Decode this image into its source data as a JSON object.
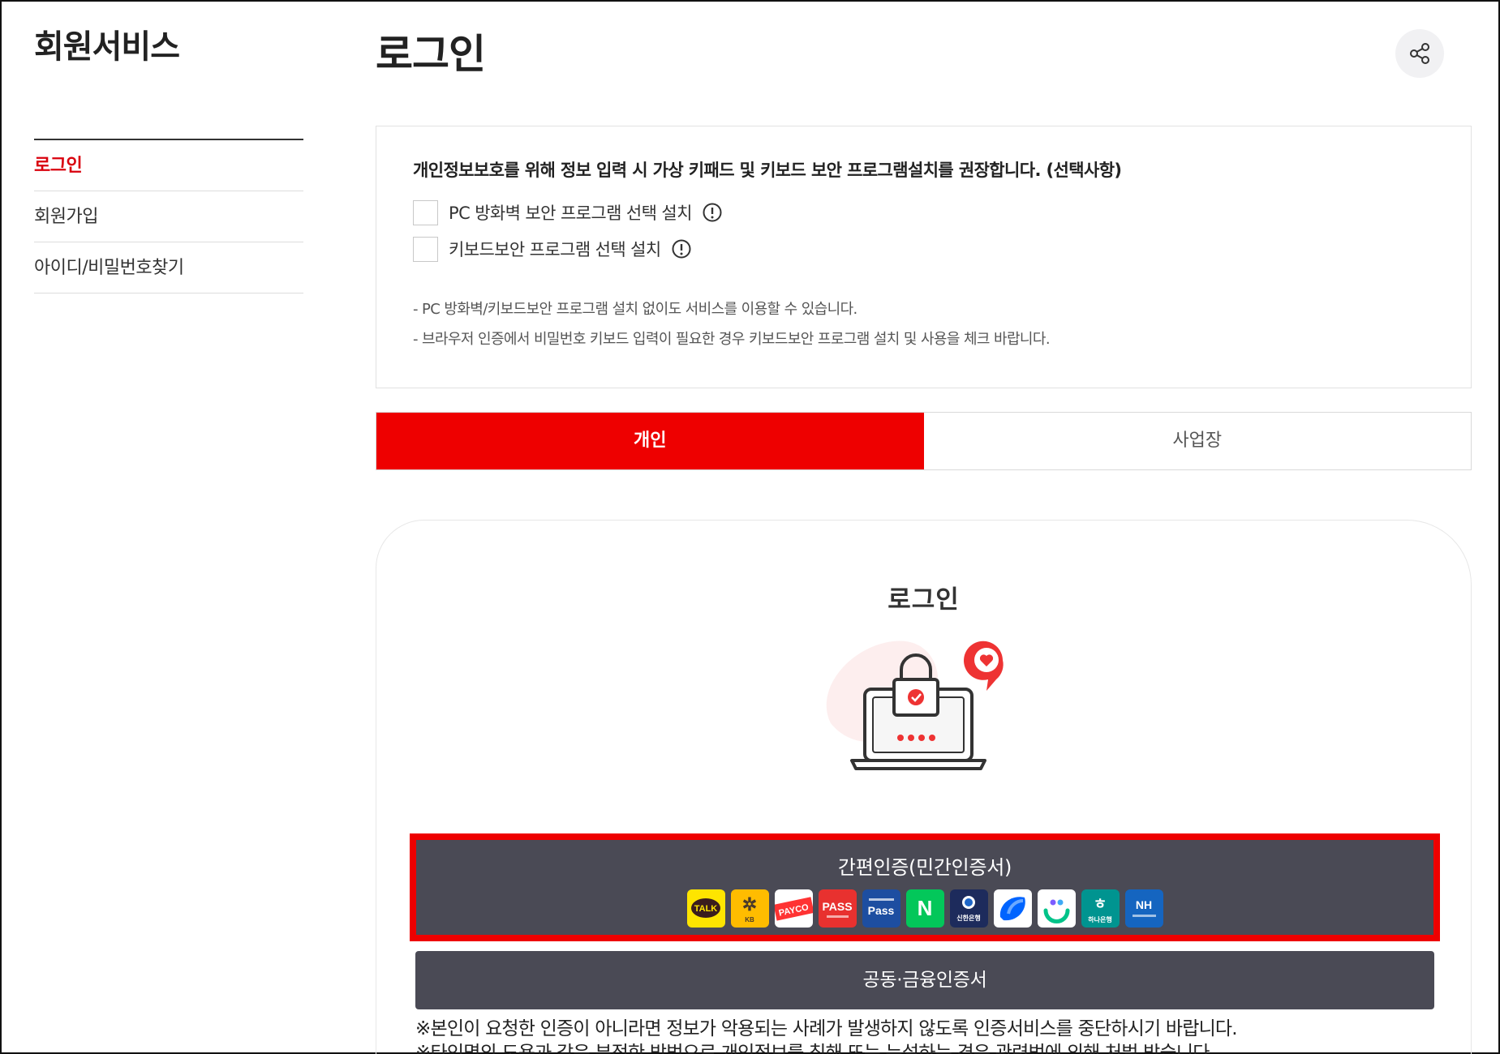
{
  "sidebar": {
    "title": "회원서비스",
    "items": [
      {
        "label": "로그인",
        "active": true
      },
      {
        "label": "회원가입",
        "active": false
      },
      {
        "label": "아이디/비밀번호찾기",
        "active": false
      }
    ]
  },
  "header": {
    "title": "로그인",
    "share_icon": "share-icon"
  },
  "notice": {
    "heading": "개인정보보호를 위해 정보 입력 시 가상 키패드 및 키보드 보안 프로그램설치를 권장합니다. (선택사항)",
    "options": [
      {
        "label": "PC 방화벽 보안 프로그램 선택 설치",
        "checked": false
      },
      {
        "label": "키보드보안 프로그램 선택 설치",
        "checked": false
      }
    ],
    "bullets": [
      "PC 방화벽/키보드보안 프로그램 설치 없이도 서비스를 이용할 수 있습니다.",
      "브라우저 인증에서 비밀번호 키보드 입력이 필요한 경우 키보드보안 프로그램 설치 및 사용을 체크 바랍니다."
    ]
  },
  "tabs": [
    {
      "label": "개인",
      "active": true
    },
    {
      "label": "사업장",
      "active": false
    }
  ],
  "login": {
    "title": "로그인",
    "simple_auth_label": "간편인증(민간인증서)",
    "providers": [
      {
        "name": "kakao-talk",
        "text": "TALK",
        "bg": "#fee500",
        "fg": "#3a1d1d"
      },
      {
        "name": "kb-bank",
        "text": "KB",
        "bg": "#ffbc00",
        "fg": "#5a4a3a"
      },
      {
        "name": "payco",
        "text": "PAYCO",
        "bg": "#ffffff",
        "fg": "#ff3333"
      },
      {
        "name": "pass",
        "text": "PASS",
        "bg": "#e8312f",
        "fg": "#ffffff"
      },
      {
        "name": "samsung-pass",
        "text": "Pass",
        "bg": "#1d4ea1",
        "fg": "#ffffff"
      },
      {
        "name": "naver",
        "text": "N",
        "bg": "#03c75a",
        "fg": "#ffffff"
      },
      {
        "name": "shinhan-bank",
        "text": "신한은행",
        "bg": "#1d2b5c",
        "fg": "#ffffff"
      },
      {
        "name": "toss",
        "text": "",
        "bg": "#ffffff",
        "fg": "#0064ff"
      },
      {
        "name": "banksalad",
        "text": "",
        "bg": "#ffffff",
        "fg": "#00c389"
      },
      {
        "name": "hana-bank",
        "text": "하나은행",
        "bg": "#009490",
        "fg": "#ffffff"
      },
      {
        "name": "nh-bank",
        "text": "NH",
        "bg": "#1565c0",
        "fg": "#ffffff"
      }
    ],
    "joint_cert_label": "공동·금융인증서",
    "warnings": [
      "※본인이 요청한 인증이 아니라면 정보가 악용되는 사례가 발생하지 않도록 인증서비스를 중단하시기 바랍니다.",
      "※타인명의 도용과 같은 부정한 방법으로 개인정보를 침해 또는 누설하는 경우 관련법에 의해 처벌 받습니다."
    ]
  },
  "colors": {
    "accent": "#ee0000",
    "active_menu": "#d9000d",
    "dark_button": "#4a4a55"
  }
}
